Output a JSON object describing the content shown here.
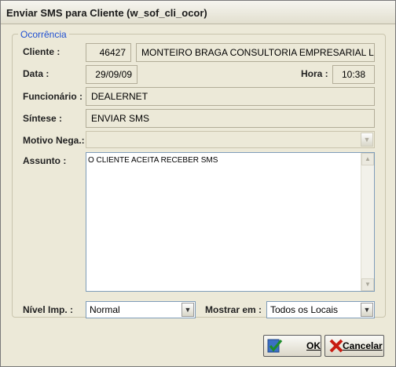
{
  "window": {
    "title": "Enviar SMS para Cliente (w_sof_cli_ocor)"
  },
  "group": {
    "legend": "Ocorrência"
  },
  "cliente": {
    "label": "Cliente :",
    "code": "46427",
    "name": "MONTEIRO BRAGA CONSULTORIA EMPRESARIAL L"
  },
  "data": {
    "label": "Data :",
    "value": "29/09/09"
  },
  "hora": {
    "label": "Hora :",
    "value": "10:38"
  },
  "funcionario": {
    "label": "Funcionário :",
    "value": "DEALERNET"
  },
  "sintese": {
    "label": "Síntese :",
    "value": "ENVIAR SMS"
  },
  "motivo": {
    "label": "Motivo Nega.:",
    "value": ""
  },
  "assunto": {
    "label": "Assunto :",
    "value": "O CLIENTE ACEITA RECEBER SMS"
  },
  "nivel": {
    "label": "Nível Imp. :",
    "value": "Normal"
  },
  "mostrar": {
    "label": "Mostrar em :",
    "value": "Todos os Locais"
  },
  "buttons": {
    "ok": "OK",
    "cancel": "Cancelar"
  },
  "icons": {
    "ok": "check-icon",
    "cancel": "x-icon"
  },
  "colors": {
    "accent": "#1f4fd1",
    "ok_green": "#1e8c2b",
    "cancel_red": "#c81c12"
  }
}
